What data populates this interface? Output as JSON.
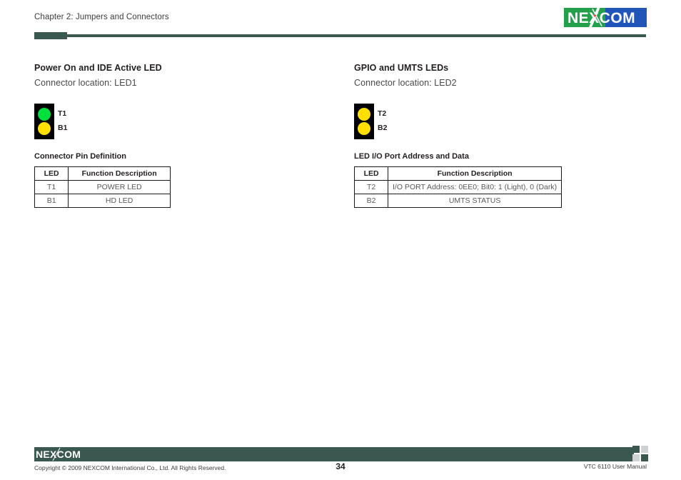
{
  "header": {
    "chapter": "Chapter 2: Jumpers and Connectors",
    "logo_text": "NEXCOM",
    "logo_green": "#22a04a",
    "logo_blue": "#2255b8",
    "accent_color": "#3a5750"
  },
  "left_column": {
    "title": "Power On and IDE Active LED",
    "connector_location": "Connector location: LED1",
    "diagram": {
      "top_label": "T1",
      "bottom_label": "B1",
      "top_color": "#00e03c",
      "bottom_color": "#ffe000",
      "body_color": "#000000"
    },
    "table_caption": "Connector Pin Definition",
    "table": {
      "headers": [
        "LED",
        "Function Description"
      ],
      "rows": [
        [
          "T1",
          "POWER LED"
        ],
        [
          "B1",
          "HD LED"
        ]
      ]
    }
  },
  "right_column": {
    "title": "GPIO and UMTS LEDs",
    "connector_location": "Connector location: LED2",
    "diagram": {
      "top_label": "T2",
      "bottom_label": "B2",
      "top_color": "#ffe000",
      "bottom_color": "#ffe000",
      "body_color": "#000000"
    },
    "table_caption": "LED I/O Port Address and Data",
    "table": {
      "headers": [
        "LED",
        "Function Description"
      ],
      "rows": [
        [
          "T2",
          "I/O PORT Address: 0EE0; Bit0: 1 (Light), 0 (Dark)"
        ],
        [
          "B2",
          "UMTS STATUS"
        ]
      ]
    }
  },
  "footer": {
    "logo_text": "NEXCOM",
    "copyright": "Copyright © 2009 NEXCOM International Co., Ltd. All Rights Reserved.",
    "page_number": "34",
    "manual_name": "VTC 6110 User Manual",
    "bar_color": "#3a5750",
    "square_light": "#cfd2d3"
  }
}
